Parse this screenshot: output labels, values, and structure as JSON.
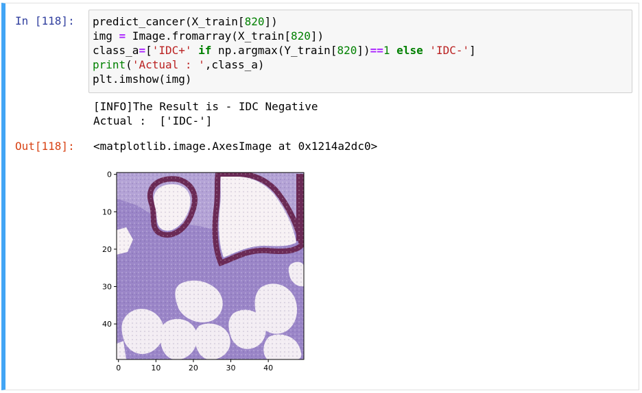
{
  "input_prompt": "In [118]:",
  "output_prompt": "Out[118]:",
  "code": {
    "line1": {
      "a": "predict_cancer(X_train[",
      "n": "820",
      "b": "])"
    },
    "line2": {
      "a": "img ",
      "op": "=",
      "b": " Image.fromarray(X_train[",
      "n": "820",
      "c": "])"
    },
    "line3": {
      "a": "class_a",
      "eq": "=",
      "b": "[",
      "s1": "'IDC+'",
      "sp1": " ",
      "kw_if": "if",
      "c": " np.argmax(Y_train[",
      "n": "820",
      "d": "])",
      "eqeq": "==",
      "one": "1",
      "sp2": " ",
      "kw_else": "else",
      "sp3": " ",
      "s2": "'IDC-'",
      "e": "]"
    },
    "line4": {
      "fn": "print",
      "a": "(",
      "s": "'Actual : '",
      "b": ",class_a)"
    },
    "line5": "plt.imshow(img)"
  },
  "stream_output": [
    "[INFO]The Result is - IDC Negative",
    "Actual :  ['IDC-']"
  ],
  "result_text": "<matplotlib.image.AxesImage at 0x1214a2dc0>",
  "chart_data": {
    "type": "heatmap",
    "image_size": [
      50,
      50
    ],
    "x_ticks": [
      0,
      10,
      20,
      30,
      40
    ],
    "y_ticks": [
      0,
      10,
      20,
      30,
      40
    ],
    "x_tick_labels": [
      "0",
      "10",
      "20",
      "30",
      "40"
    ],
    "y_tick_labels": [
      "0",
      "10",
      "20",
      "30",
      "40"
    ],
    "xlim": [
      -0.5,
      49.5
    ],
    "ylim": [
      49.5,
      -0.5
    ],
    "colors": {
      "stroma": "#9b86c8",
      "stroma_light": "#b4a3d6",
      "wall": "#6b2a55",
      "lumen": "#f7f1f4",
      "fat": "#f3edf3"
    }
  }
}
